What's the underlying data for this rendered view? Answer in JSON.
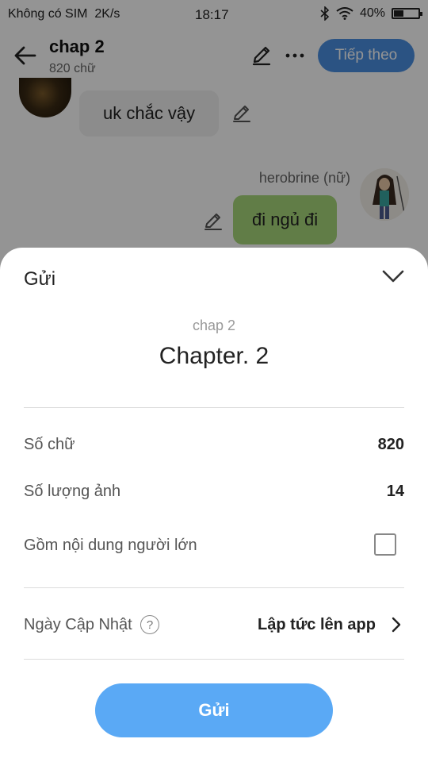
{
  "status_bar": {
    "carrier": "Không có SIM",
    "speed": "2K/s",
    "time": "18:17",
    "battery": "40%",
    "battery_level": 0.4
  },
  "app_bar": {
    "title": "chap 2",
    "subtitle": "820 chữ",
    "next_label": "Tiếp theo"
  },
  "chat": {
    "message_left": "uk chắc vậy",
    "username_right": "herobrine (nữ)",
    "message_right": "đi ngủ đi"
  },
  "sheet": {
    "title": "Gửi",
    "subtitle": "chap 2",
    "heading": "Chapter. 2",
    "word_count_label": "Số chữ",
    "word_count_value": "820",
    "image_count_label": "Số lượng ảnh",
    "image_count_value": "14",
    "adult_label": "Gồm nội dung người lớn",
    "adult_checked": false,
    "update_date_label": "Ngày Cập Nhật",
    "help_glyph": "?",
    "update_date_value": "Lập tức lên app",
    "send_label": "Gửi"
  },
  "colors": {
    "accent": "#4a90e2",
    "send_button": "#5aa9f5",
    "bubble_right": "#a8d87a",
    "bubble_left": "#f2f2f2"
  }
}
